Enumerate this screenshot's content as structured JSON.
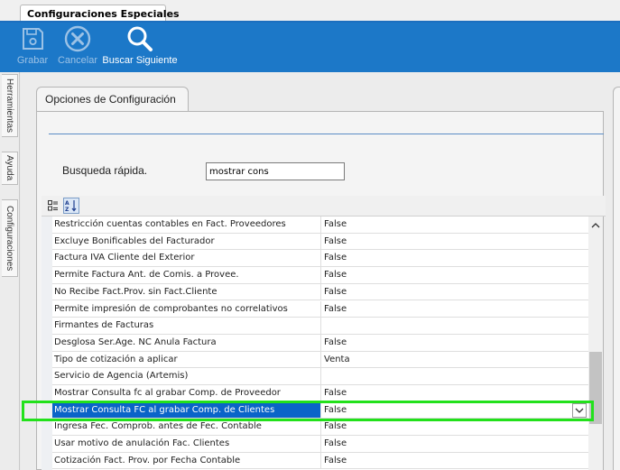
{
  "window_tab": {
    "label": "Configuraciones Especiales"
  },
  "toolbar": {
    "grabar": "Grabar",
    "cancelar": "Cancelar",
    "buscar_siguiente": "Buscar Siguiente"
  },
  "side_tabs": [
    "Herramientas",
    "Ayuda",
    "Configuraciones"
  ],
  "panel": {
    "title": "Opciones de Configuración",
    "search_label": "Busqueda rápida.",
    "search_value": "mostrar cons"
  },
  "grid": {
    "rows": [
      {
        "name": "Restricción cuentas contables en Fact. Proveedores",
        "value": "False"
      },
      {
        "name": "Excluye Bonificables del Facturador",
        "value": "False"
      },
      {
        "name": "Factura IVA Cliente del Exterior",
        "value": "False"
      },
      {
        "name": "Permite Factura Ant. de Comis. a Provee.",
        "value": "False"
      },
      {
        "name": "No Recibe Fact.Prov. sin Fact.Cliente",
        "value": "False"
      },
      {
        "name": "Permite impresión de comprobantes no correlativos",
        "value": "False"
      },
      {
        "name": "Firmantes de Facturas",
        "value": ""
      },
      {
        "name": "Desglosa Ser.Age. NC Anula Factura",
        "value": "False"
      },
      {
        "name": "Tipo de cotización a aplicar",
        "value": "Venta"
      },
      {
        "name": "Servicio de Agencia (Artemis)",
        "value": ""
      },
      {
        "name": "Mostrar Consulta fc al grabar Comp. de Proveedor",
        "value": "False"
      },
      {
        "name": "Mostrar Consulta FC al grabar Comp. de Clientes",
        "value": "False",
        "selected": true
      },
      {
        "name": "Ingresa Fec. Comprob. antes de Fec. Contable",
        "value": "False"
      },
      {
        "name": "Usar motivo de anulación Fac. Clientes",
        "value": "False"
      },
      {
        "name": "Cotización Fact. Prov. por Fecha Contable",
        "value": "False"
      }
    ]
  },
  "colors": {
    "toolbar_bg": "#1c78c8",
    "selection_bg": "#0a64c8",
    "highlight_border": "#22e11b"
  },
  "icons": {
    "grabar": "floppy-disk-icon",
    "cancelar": "cancel-circle-icon",
    "buscar": "magnifier-icon",
    "categorized": "categorized-view-icon",
    "alphabetical": "sort-alphabetical-icon"
  }
}
